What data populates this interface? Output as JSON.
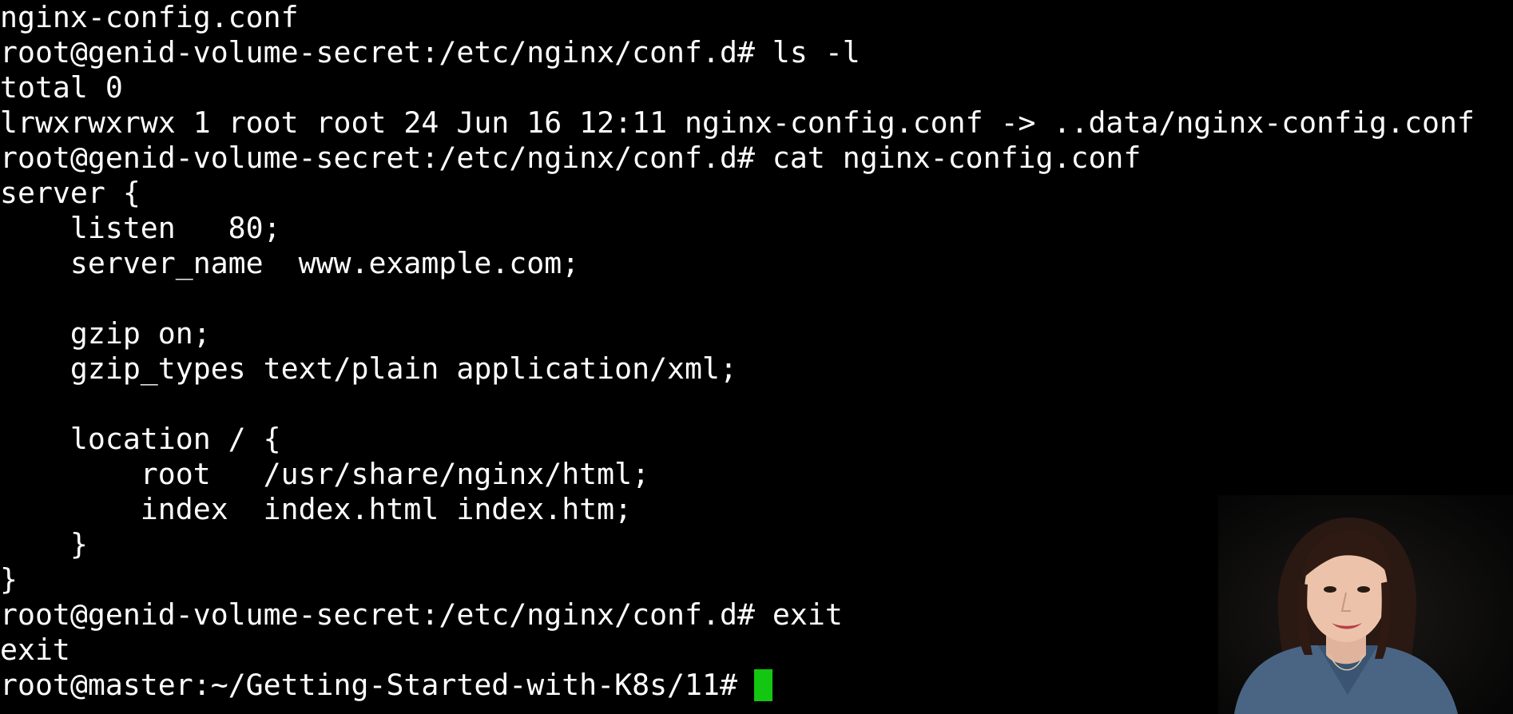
{
  "terminal": {
    "lines": [
      "nginx-config.conf",
      "root@genid-volume-secret:/etc/nginx/conf.d# ls -l",
      "total 0",
      "lrwxrwxrwx 1 root root 24 Jun 16 12:11 nginx-config.conf -> ..data/nginx-config.conf",
      "root@genid-volume-secret:/etc/nginx/conf.d# cat nginx-config.conf",
      "server {",
      "    listen   80;",
      "    server_name  www.example.com;",
      "",
      "    gzip on;",
      "    gzip_types text/plain application/xml;",
      "",
      "    location / {",
      "        root   /usr/share/nginx/html;",
      "        index  index.html index.htm;",
      "    }",
      "}",
      "root@genid-volume-secret:/etc/nginx/conf.d# exit",
      "exit",
      "root@master:~/Getting-Started-with-K8s/11# "
    ],
    "cursor_color": "#12c612",
    "background": "#000000",
    "foreground": "#ffffff"
  },
  "webcam": {
    "icon": "presenter-video-overlay"
  }
}
